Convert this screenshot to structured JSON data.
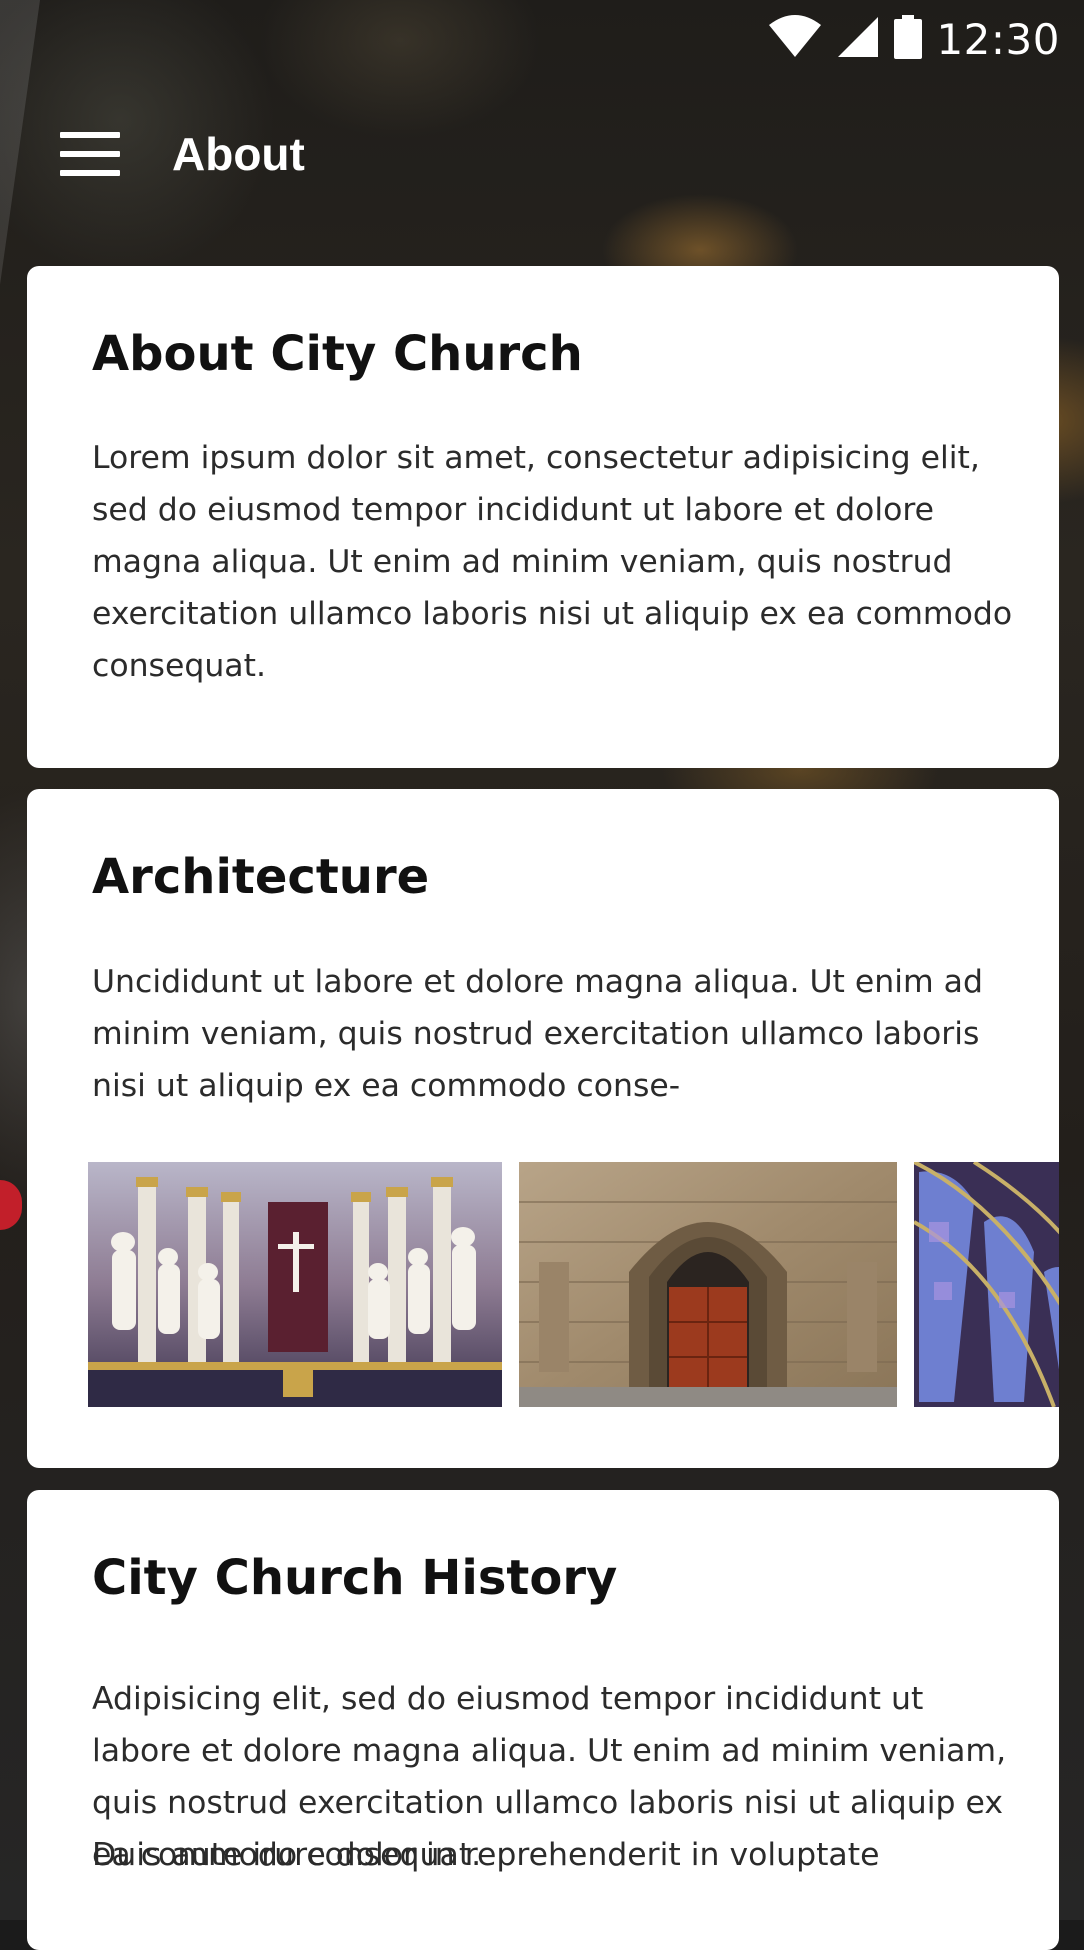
{
  "status_bar": {
    "time": "12:30",
    "icons": [
      "wifi-icon",
      "signal-icon",
      "battery-icon"
    ]
  },
  "app_bar": {
    "title": "About",
    "menu_icon": "hamburger-menu-icon"
  },
  "cards": {
    "about": {
      "title": "About City Church",
      "body": "Lorem ipsum dolor sit amet, consectetur adipisicing elit, sed do eiusmod tempor incididunt ut labore et dolore magna aliqua. Ut enim ad minim veniam, quis nostrud exercitation ullamco laboris nisi ut aliquip ex ea commodo consequat."
    },
    "architecture": {
      "title": "Architecture",
      "body": "Uncididunt ut labore et dolore magna aliqua. Ut enim ad minim veniam, quis nostrud exercitation ullamco laboris nisi ut aliquip ex ea commodo conse-",
      "images": [
        "altar-statues-image",
        "gothic-doorway-image",
        "stained-glass-image"
      ]
    },
    "history": {
      "title": "City Church History",
      "body": "Adipisicing elit, sed do eiusmod tempor incididunt ut labore et dolore magna aliqua. Ut enim ad minim veniam, quis nostrud exercitation ullamco laboris nisi ut aliquip ex ea commodo consequat.",
      "body_2": "Duis aute irure dolor in reprehenderit in voluptate"
    }
  },
  "colors": {
    "card_background": "#ffffff",
    "title_text": "#111111",
    "body_text": "#2b2b2b",
    "app_bar_text": "#ffffff"
  }
}
